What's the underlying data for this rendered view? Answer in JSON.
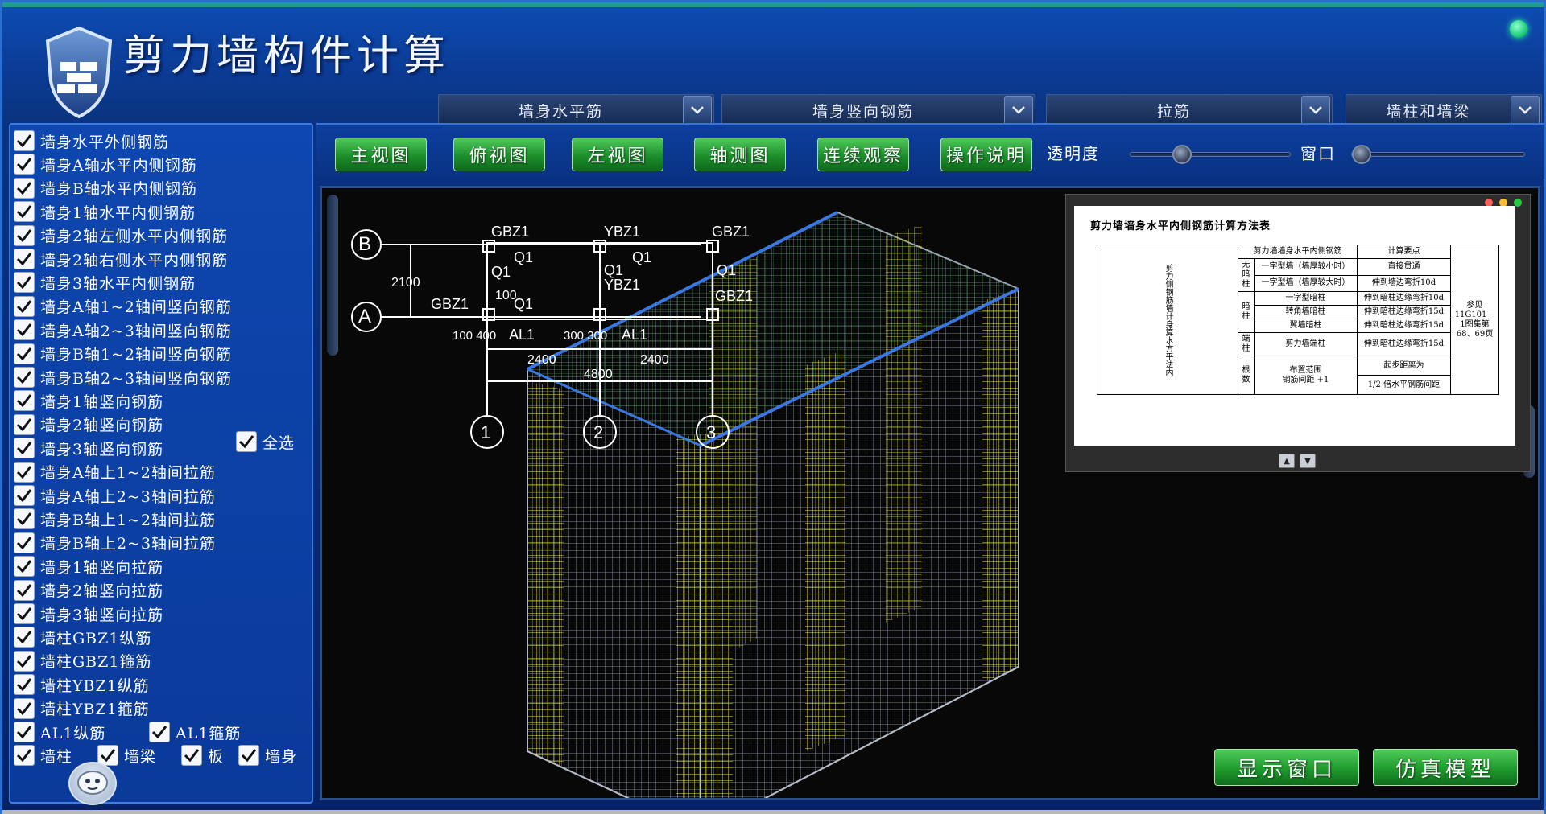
{
  "app": {
    "title": "剪力墙构件计算",
    "logo_icon": "shield-icon",
    "accent_color": "#0b3f9c"
  },
  "dropdowns": [
    {
      "label": "墙身水平筋"
    },
    {
      "label": "墙身竖向钢筋"
    },
    {
      "label": "拉筋"
    },
    {
      "label": "墙柱和墙梁"
    }
  ],
  "sidebar": {
    "items": [
      {
        "label": "墙身水平外侧钢筋",
        "checked": true
      },
      {
        "label": "墙身A轴水平内侧钢筋",
        "checked": true
      },
      {
        "label": "墙身B轴水平内侧钢筋",
        "checked": true
      },
      {
        "label": "墙身1轴水平内侧钢筋",
        "checked": true
      },
      {
        "label": "墙身2轴左侧水平内侧钢筋",
        "checked": true
      },
      {
        "label": "墙身2轴右侧水平内侧钢筋",
        "checked": true
      },
      {
        "label": "墙身3轴水平内侧钢筋",
        "checked": true
      },
      {
        "label": "墙身A轴1~2轴间竖向钢筋",
        "checked": true
      },
      {
        "label": "墙身A轴2~3轴间竖向钢筋",
        "checked": true
      },
      {
        "label": "墙身B轴1~2轴间竖向钢筋",
        "checked": true
      },
      {
        "label": "墙身B轴2~3轴间竖向钢筋",
        "checked": true
      },
      {
        "label": "墙身1轴竖向钢筋",
        "checked": true
      },
      {
        "label": "墙身2轴竖向钢筋",
        "checked": true
      },
      {
        "label": "墙身3轴竖向钢筋",
        "checked": true
      },
      {
        "label": "墙身A轴上1~2轴间拉筋",
        "checked": true
      },
      {
        "label": "墙身A轴上2~3轴间拉筋",
        "checked": true
      },
      {
        "label": "墙身B轴上1~2轴间拉筋",
        "checked": true
      },
      {
        "label": "墙身B轴上2~3轴间拉筋",
        "checked": true
      },
      {
        "label": "墙身1轴竖向拉筋",
        "checked": true
      },
      {
        "label": "墙身2轴竖向拉筋",
        "checked": true
      },
      {
        "label": "墙身3轴竖向拉筋",
        "checked": true
      },
      {
        "label": "墙柱GBZ1纵筋",
        "checked": true
      },
      {
        "label": "墙柱GBZ1箍筋",
        "checked": true
      },
      {
        "label": "墙柱YBZ1纵筋",
        "checked": true
      },
      {
        "label": "墙柱YBZ1箍筋",
        "checked": true
      }
    ],
    "select_all": {
      "label": "全选",
      "checked": true
    },
    "al_items": [
      {
        "label": "AL1纵筋",
        "checked": true
      },
      {
        "label": "AL1箍筋",
        "checked": true
      }
    ],
    "category_items": [
      {
        "label": "墙柱",
        "checked": true
      },
      {
        "label": "墙梁",
        "checked": true
      },
      {
        "label": "板",
        "checked": true
      },
      {
        "label": "墙身",
        "checked": true
      }
    ]
  },
  "toolbar": {
    "buttons": [
      "主视图",
      "俯视图",
      "左视图",
      "轴测图",
      "连续观察",
      "操作说明"
    ],
    "transparency_label": "透明度",
    "window_label": "窗口",
    "transparency_value": 0.3,
    "window_value": 0.0
  },
  "plan": {
    "axis_b": "B",
    "axis_a": "A",
    "axis_1": "1",
    "axis_2": "2",
    "axis_3": "3",
    "gbz1_left": "GBZ1",
    "ybz1_top": "YBZ1",
    "gbz1_right": "GBZ1",
    "gbz1_lower_left": "GBZ1",
    "gbz1_lower_right": "GBZ1",
    "ybz1_mid": "YBZ1",
    "q1_a": "Q1",
    "q1_b": "Q1",
    "q1_c": "Q1",
    "q1_d": "Q1",
    "q1_e": "Q1",
    "q1_f": "Q1",
    "al1_a": "AL1",
    "al1_b": "AL1",
    "dim_2100": "2100",
    "dim_100_400": "100 400",
    "dim_300_300": "300 300",
    "dim_2400_left": "2400",
    "dim_2400_right": "2400",
    "dim_4800": "4800",
    "dim_100": "100"
  },
  "info_panel": {
    "title": "剪力墙墙身水平内侧钢筋计算方法表",
    "col_header_1": "剪力墙墙身水平内侧钢筋",
    "col_header_2": "计算要点",
    "left_group": "剪力侧钢筋墙计身算水方平法内",
    "rows": [
      {
        "group": "无暗柱",
        "item": "一字型墙（墙厚较小时）",
        "point": "直接贯通"
      },
      {
        "group": "",
        "item": "一字型墙（墙厚较大时）",
        "point": "伸到墙边弯折10d"
      },
      {
        "group": "暗柱",
        "item": "一字型暗柱",
        "point": "伸到暗柱边缘弯折10d"
      },
      {
        "group": "",
        "item": "转角墙暗柱",
        "point": "伸到暗柱边缘弯折15d"
      },
      {
        "group": "",
        "item": "翼墙暗柱",
        "point": "伸到暗柱边缘弯折15d"
      },
      {
        "group": "端柱",
        "item": "剪力墙端柱",
        "point": "伸到暗柱边缘弯折15d"
      }
    ],
    "count_label": "根数",
    "count_formula_a": "布置范围",
    "count_formula_b": "钢筋间距",
    "count_formula_plus": "+1",
    "start_distance": "起步距离为",
    "half_spacing_num": "1",
    "half_spacing_den": "2",
    "half_spacing_text": "倍水平钢筋间距",
    "reference": "参见11G101—1图集第68、69页"
  },
  "actions": {
    "show_window": "显示窗口",
    "simulate_model": "仿真模型"
  }
}
